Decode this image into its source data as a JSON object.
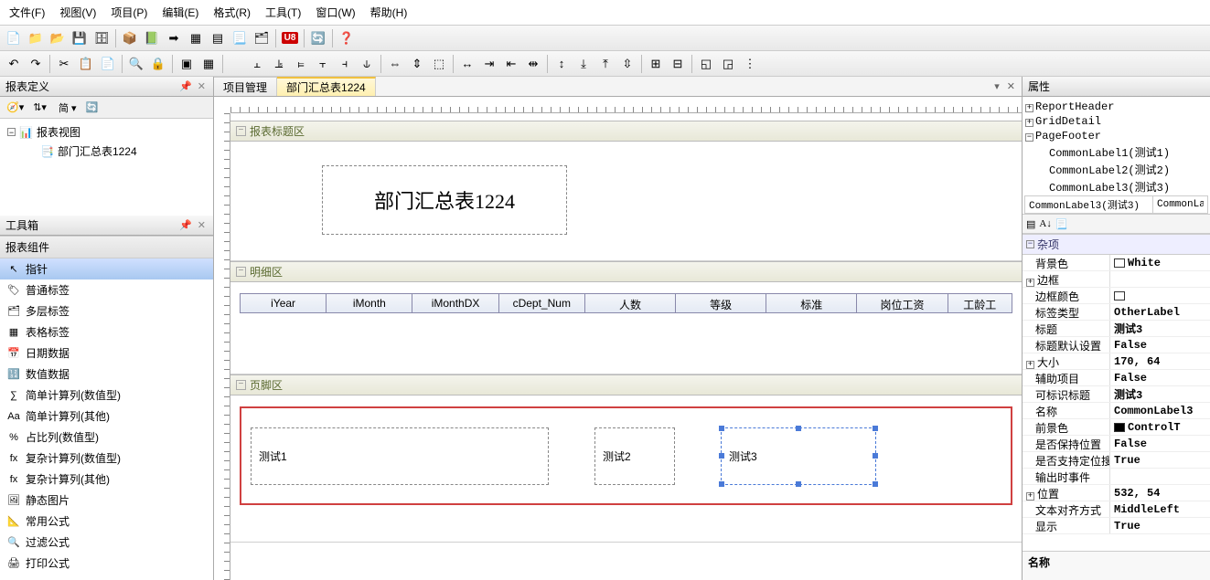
{
  "menu": {
    "file": "文件(F)",
    "view": "视图(V)",
    "project": "项目(P)",
    "edit": "编辑(E)",
    "format": "格式(R)",
    "tools": "工具(T)",
    "window": "窗口(W)",
    "help": "帮助(H)"
  },
  "left": {
    "reportDef": "报表定义",
    "combo_simple": "简",
    "tree": {
      "root": "报表视图",
      "node1": "部门汇总表1224"
    },
    "toolbox": "工具箱",
    "section": "报表组件",
    "items": [
      "指针",
      "普通标签",
      "多层标签",
      "表格标签",
      "日期数据",
      "数值数据",
      "简单计算列(数值型)",
      "简单计算列(其他)",
      "占比列(数值型)",
      "复杂计算列(数值型)",
      "复杂计算列(其他)",
      "静态图片",
      "常用公式",
      "过滤公式",
      "打印公式"
    ]
  },
  "tabs": {
    "t1": "项目管理",
    "t2": "部门汇总表1224"
  },
  "sections": {
    "title": "报表标题区",
    "detail": "明细区",
    "footer": "页脚区"
  },
  "reportTitle": "部门汇总表1224",
  "gridCols": [
    "iYear",
    "iMonth",
    "iMonthDX",
    "cDept_Num",
    "人数",
    "等级",
    "标准",
    "岗位工资",
    "工龄工"
  ],
  "footerLabels": {
    "l1": "测试1",
    "l2": "测试2",
    "l3": "测试3"
  },
  "right": {
    "title": "属性",
    "tree": {
      "rh": "ReportHeader",
      "gd": "GridDetail",
      "pf": "PageFooter",
      "c1": "CommonLabel1(测试1)",
      "c2": "CommonLabel2(测试2)",
      "c3": "CommonLabel3(测试3)"
    },
    "comboName": "CommonLabel3(测试3)",
    "comboType": "CommonLabe",
    "cat_misc": "杂项",
    "props": {
      "bgcolor_k": "背景色",
      "bgcolor_v": "White",
      "border_k": "边框",
      "bordercolor_k": "边框颜色",
      "labeltype_k": "标签类型",
      "labeltype_v": "OtherLabel",
      "title_k": "标题",
      "title_v": "测试3",
      "titledef_k": "标题默认设置",
      "titledef_v": "False",
      "size_k": "大小",
      "size_v": "170, 64",
      "aux_k": "辅助项目",
      "aux_v": "False",
      "marktitle_k": "可标识标题",
      "marktitle_v": "测试3",
      "name_k": "名称",
      "name_v": "CommonLabel3",
      "fgcolor_k": "前景色",
      "fgcolor_v": "ControlT",
      "keeppos_k": "是否保持位置",
      "keeppos_v": "False",
      "search_k": "是否支持定位搜索",
      "search_v": "True",
      "outevt_k": "输出时事件",
      "pos_k": "位置",
      "pos_v": "532, 54",
      "align_k": "文本对齐方式",
      "align_v": "MiddleLeft",
      "show_k": "显示",
      "show_v": "True"
    },
    "desc_name": "名称"
  }
}
